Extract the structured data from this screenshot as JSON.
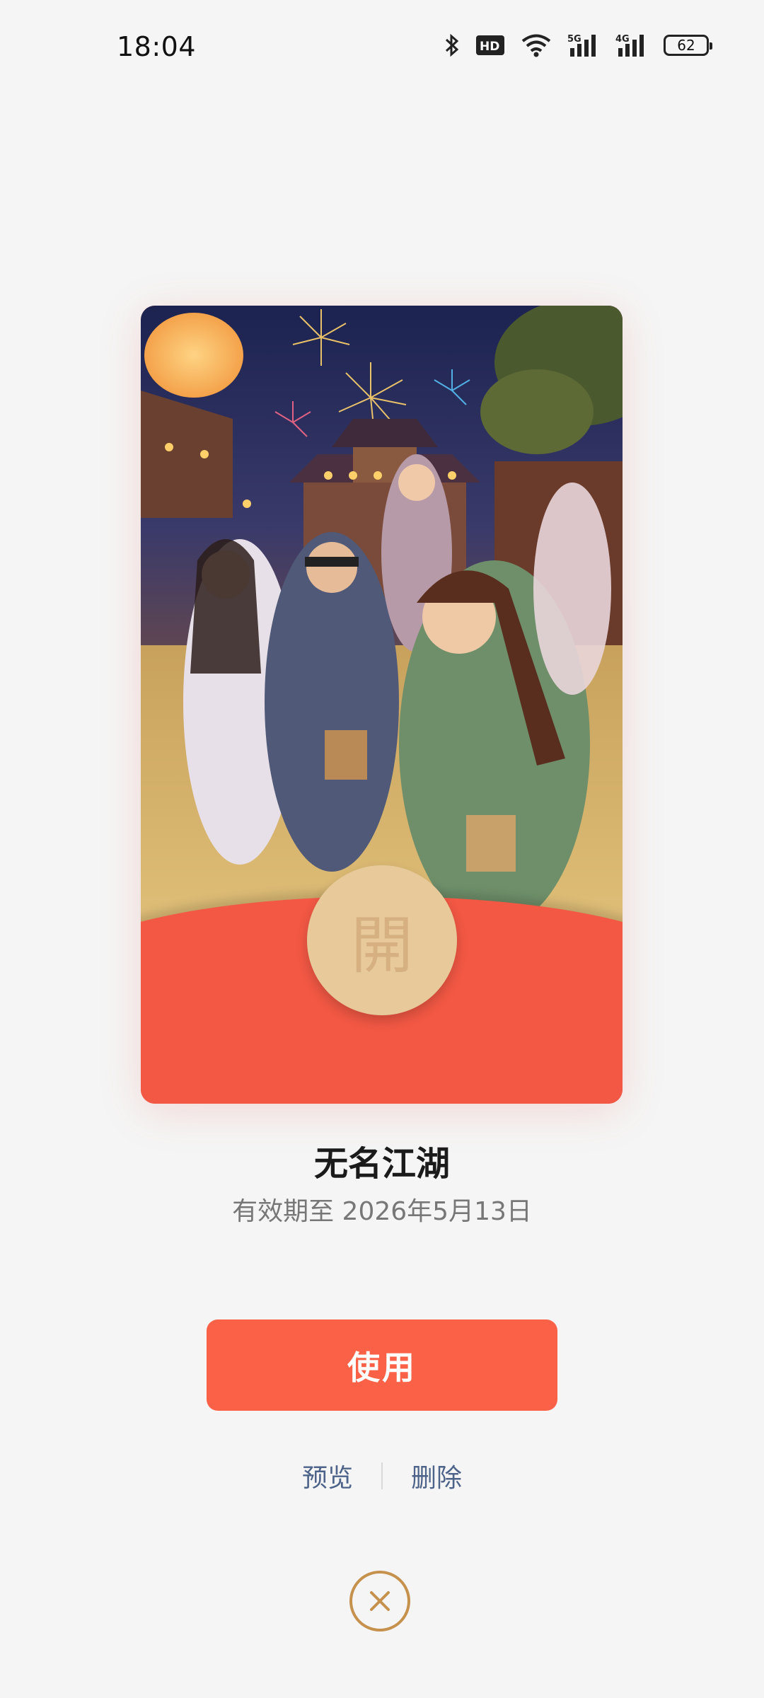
{
  "status_bar": {
    "time": "18:04",
    "icons": [
      "bluetooth-icon",
      "hd-icon",
      "wifi-icon",
      "signal-5g-icon",
      "signal-4g-icon",
      "battery-icon"
    ],
    "battery_level": "62"
  },
  "card": {
    "open_label": "開",
    "colors": {
      "envelope": "#f25844",
      "open_button": "#e8c99a"
    }
  },
  "title": "无名江湖",
  "validity": "有效期至 2026年5月13日",
  "actions": {
    "use_label": "使用",
    "preview_label": "预览",
    "delete_label": "删除"
  },
  "colors": {
    "primary": "#fb6146",
    "link": "#4d6389",
    "close": "#c5914d"
  }
}
